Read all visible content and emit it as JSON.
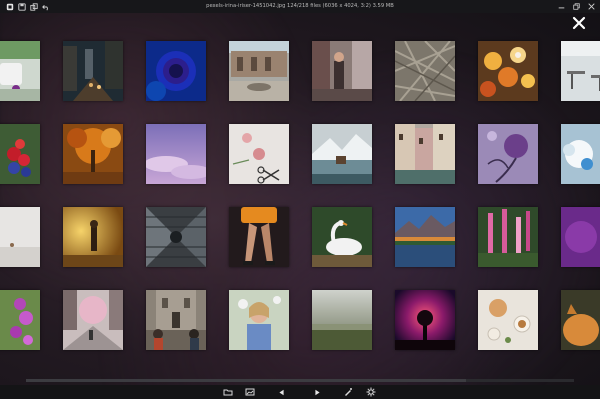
{
  "window": {
    "title": "pexels-irina-iriser-1451042.jpg  124/218 files  (6036 x 4024, 3:2)  3.59 MB"
  },
  "titlebar_icons": [
    "app-icon",
    "save-icon",
    "copy-icon",
    "undo-icon"
  ],
  "window_controls": [
    "minimize-icon",
    "restore-icon",
    "close-window-icon"
  ],
  "grid": {
    "rows": [
      [
        "mug",
        "city-street",
        "blue-rose",
        "palace-fountain",
        "street-people",
        "dry-grass",
        "orange-flowers",
        "cafe"
      ],
      [
        "berries",
        "autumn-forest",
        "purple-sky",
        "flowers-scissors",
        "mountain-lake-house",
        "canal-houses",
        "purple-tulip",
        "white-flower"
      ],
      [
        "cup-white",
        "girl-sunset",
        "building-interior",
        "woman-legs-orange",
        "swan",
        "mountain-lake-sunset",
        "foxglove-flowers",
        "purple-abstract"
      ],
      [
        "purple-flower",
        "blossom-street",
        "old-building-people",
        "girl-flowers",
        "foggy-field",
        "tree-galaxy",
        "pastries-table",
        "orange-cat"
      ]
    ]
  },
  "toolbar": {
    "items": [
      "folder-icon",
      "gallery-icon",
      "previous-icon",
      "next-icon",
      "edit-icon",
      "settings-icon"
    ]
  }
}
